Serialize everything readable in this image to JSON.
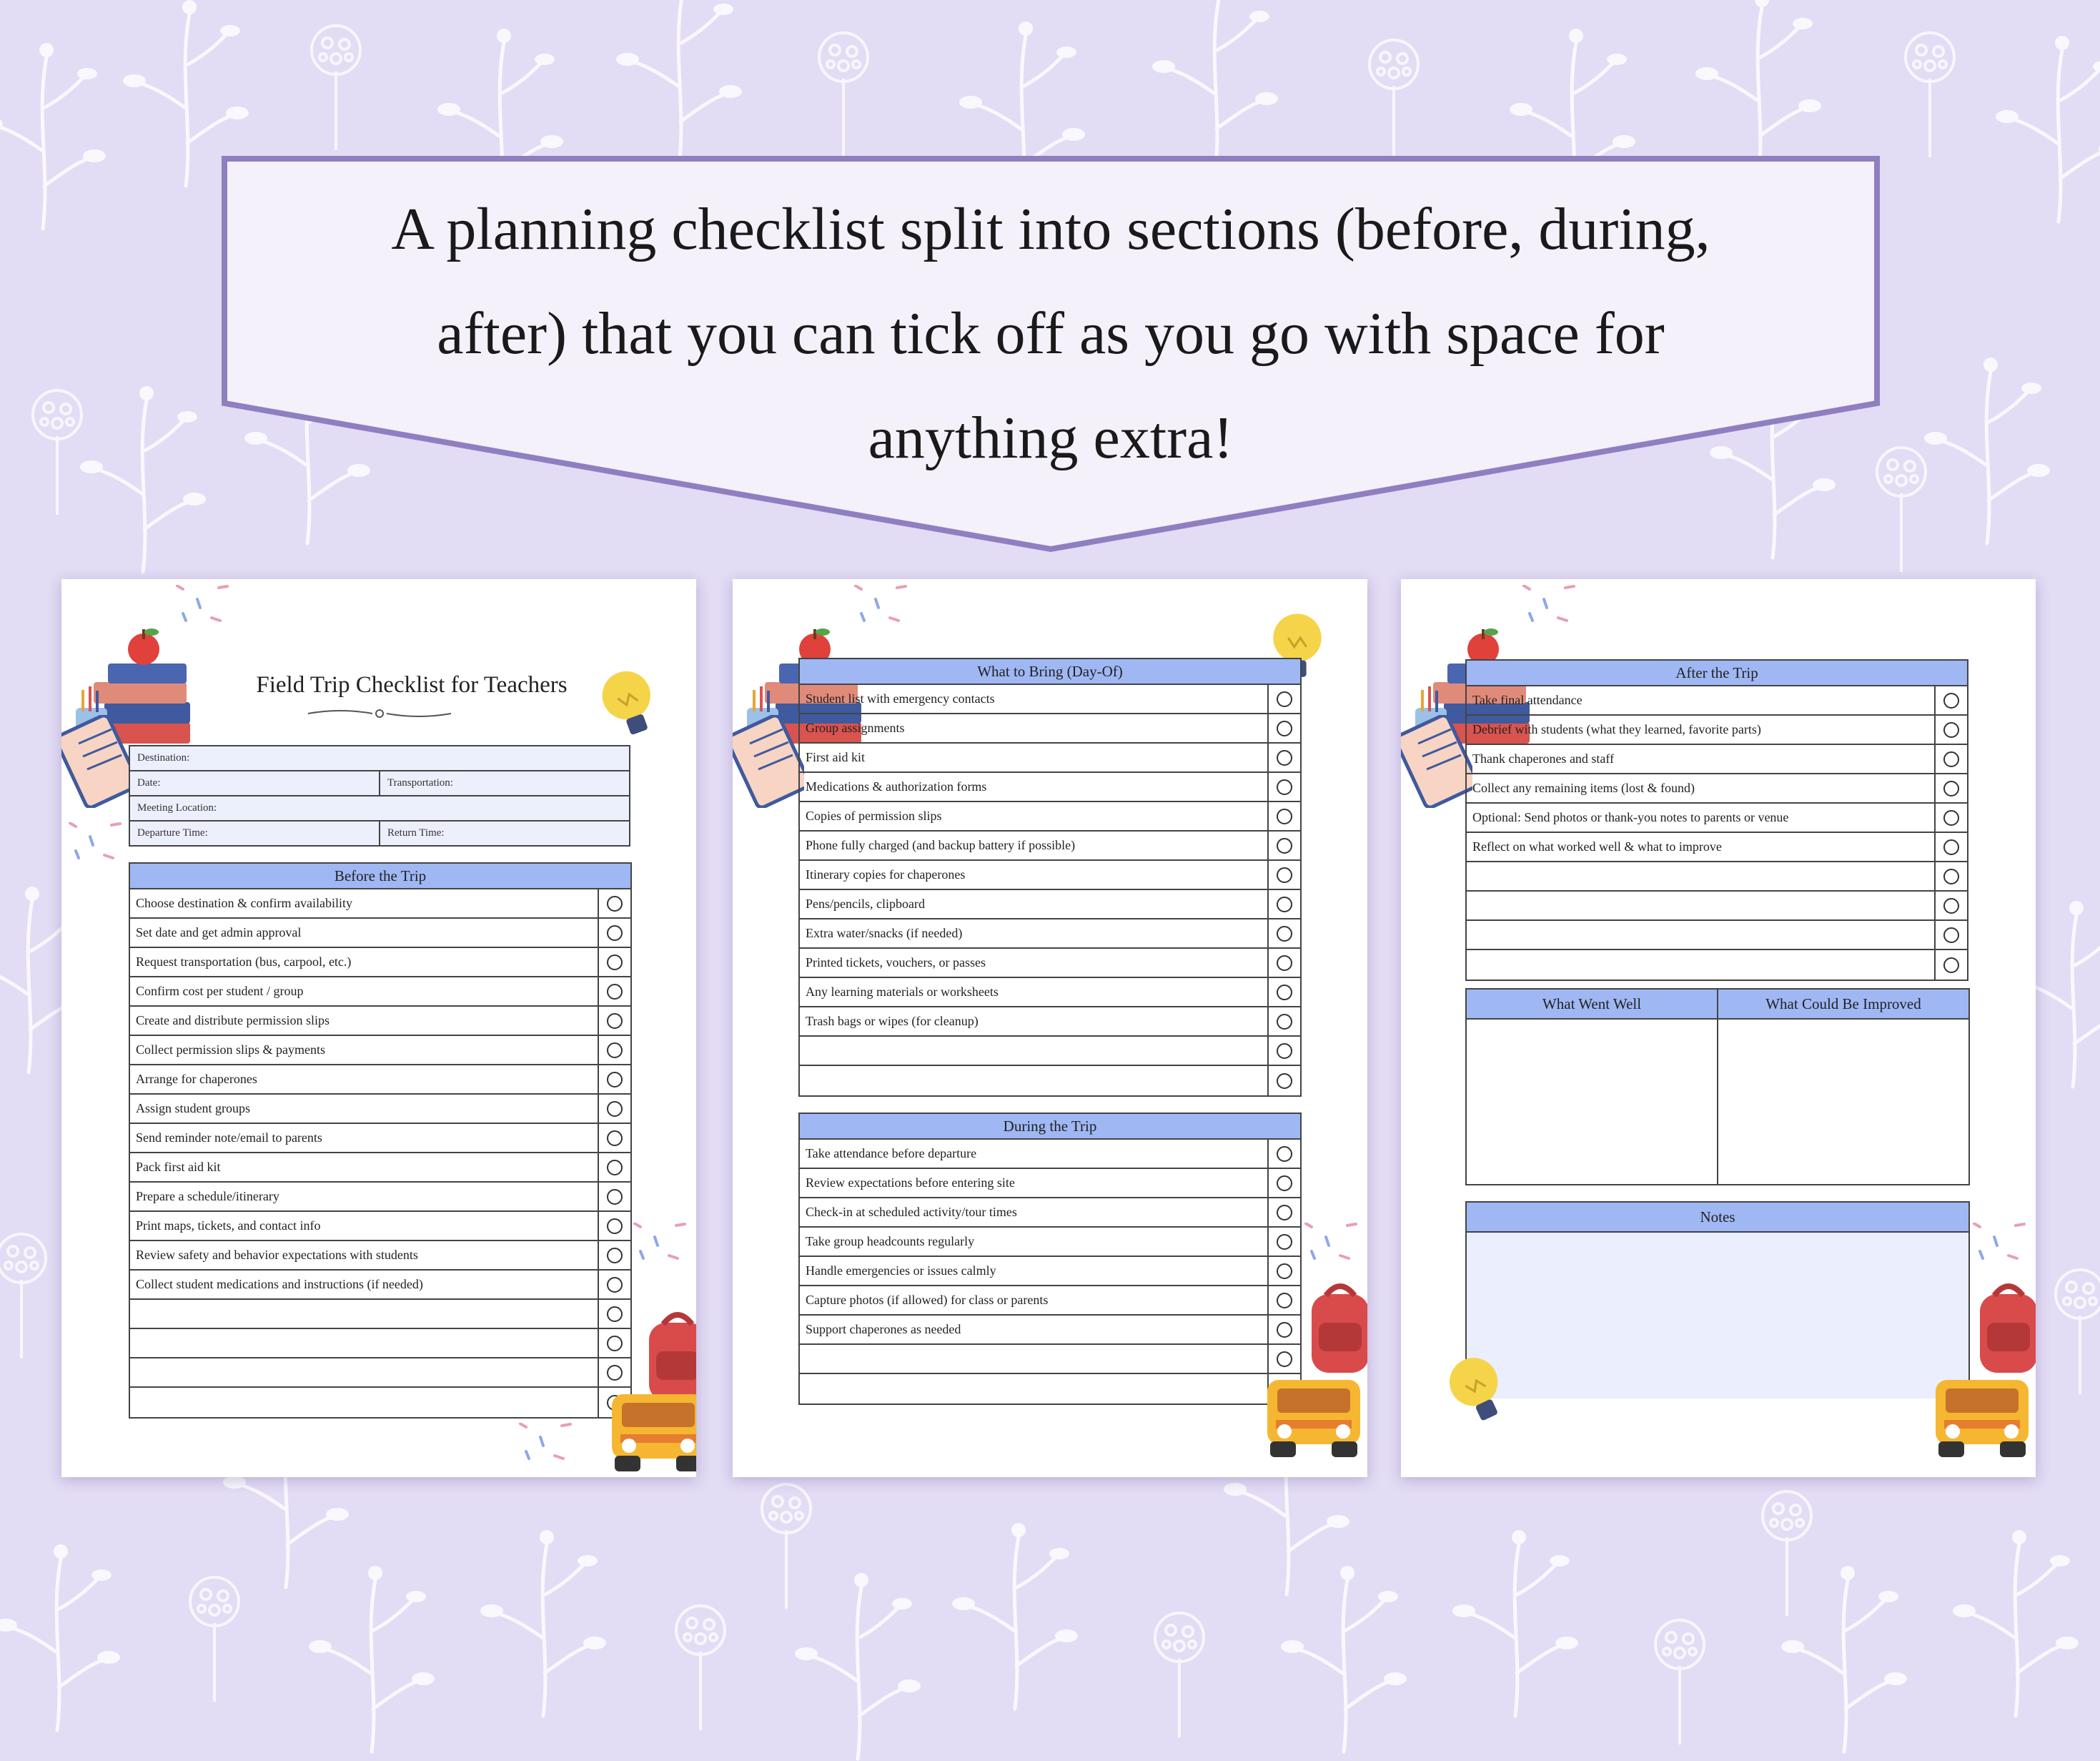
{
  "banner": {
    "line1": "A planning checklist split into sections (before, during,",
    "line2": "after) that you can tick off as you go with space for",
    "line3": "anything extra!"
  },
  "page1": {
    "title": "Field Trip Checklist for Teachers",
    "fields": {
      "destination": "Destination:",
      "date": "Date:",
      "transportation": "Transportation:",
      "meeting_location": "Meeting Location:",
      "departure_time": "Departure Time:",
      "return_time": "Return Time:"
    },
    "before": {
      "heading": "Before the Trip",
      "items": [
        "Choose destination & confirm availability",
        "Set date and get admin approval",
        "Request transportation (bus, carpool, etc.)",
        "Confirm cost per student / group",
        "Create and distribute permission slips",
        "Collect permission slips & payments",
        "Arrange for chaperones",
        "Assign student groups",
        "Send reminder note/email to parents",
        "Pack first aid kit",
        "Prepare a schedule/itinerary",
        "Print maps, tickets, and contact info",
        "Review safety and behavior expectations with students",
        "Collect student medications and instructions (if needed)",
        "",
        "",
        "",
        ""
      ]
    }
  },
  "page2": {
    "bring": {
      "heading": "What to Bring (Day-Of)",
      "items": [
        "Student list with emergency contacts",
        "Group assignments",
        "First aid kit",
        "Medications & authorization forms",
        "Copies of permission slips",
        "Phone fully charged (and backup battery if possible)",
        "Itinerary copies for chaperones",
        "Pens/pencils, clipboard",
        "Extra water/snacks (if needed)",
        "Printed tickets, vouchers, or passes",
        "Any learning materials or worksheets",
        "Trash bags or wipes (for cleanup)",
        "",
        ""
      ]
    },
    "during": {
      "heading": "During the Trip",
      "items": [
        "Take attendance before departure",
        "Review expectations before entering site",
        "Check-in at scheduled activity/tour times",
        "Take group headcounts regularly",
        "Handle emergencies or issues calmly",
        "Capture photos (if allowed) for class or parents",
        "Support chaperones as needed",
        "",
        ""
      ]
    }
  },
  "page3": {
    "after": {
      "heading": "After the Trip",
      "items": [
        "Take final attendance",
        "Debrief with students (what they learned, favorite parts)",
        "Thank chaperones and staff",
        "Collect any remaining items (lost & found)",
        "Optional: Send photos or thank-you notes to parents or venue",
        "Reflect on what worked well & what to improve",
        "",
        "",
        "",
        ""
      ]
    },
    "went_well": "What Went Well",
    "could_improve": "What Could Be Improved",
    "notes": "Notes"
  },
  "colors": {
    "background": "#e3dcf5",
    "banner_border": "#8f7fc0",
    "header_blue": "#9fb7f3",
    "field_blue": "#ecf0fd"
  }
}
